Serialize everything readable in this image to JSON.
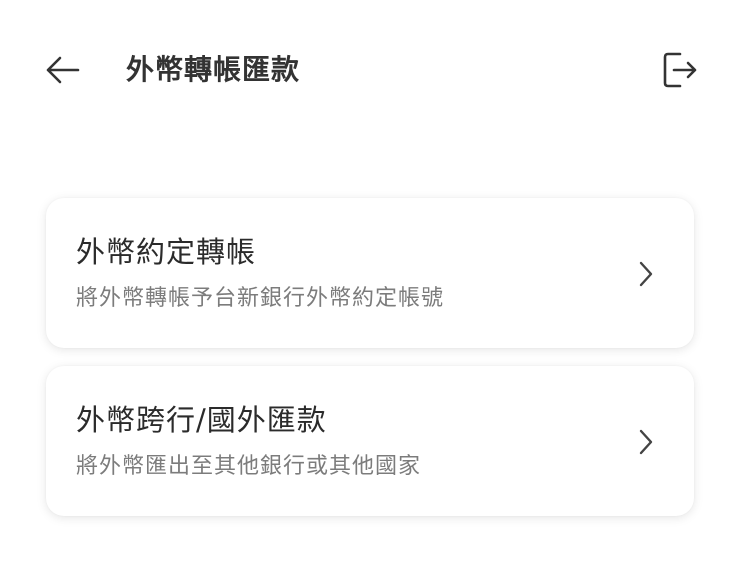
{
  "header": {
    "title": "外幣轉帳匯款",
    "back_icon": "arrow-left-icon",
    "logout_icon": "logout-icon"
  },
  "options": [
    {
      "title": "外幣約定轉帳",
      "description": "將外幣轉帳予台新銀行外幣約定帳號",
      "icon": "chevron-right-icon"
    },
    {
      "title": "外幣跨行/國外匯款",
      "description": "將外幣匯出至其他銀行或其他國家",
      "icon": "chevron-right-icon"
    }
  ],
  "colors": {
    "text_primary": "#2b2b2b",
    "text_secondary": "#7c7c7c",
    "background": "#ffffff"
  }
}
